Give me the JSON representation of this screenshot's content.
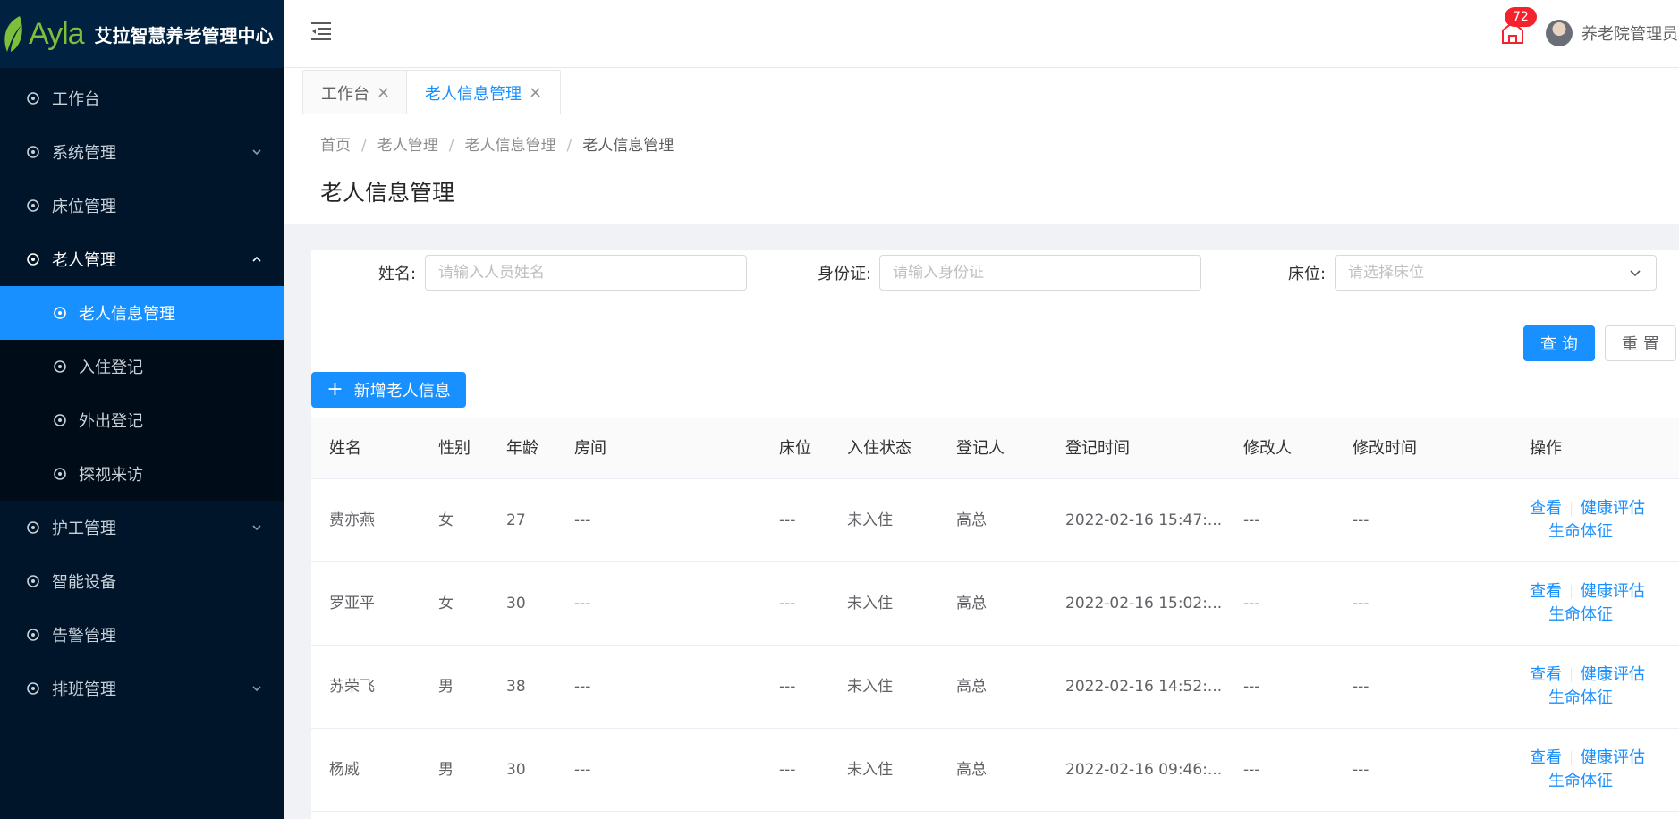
{
  "sidebar": {
    "brand": "Ayla",
    "title": "艾拉智慧养老管理中心",
    "items": [
      {
        "label": "工作台"
      },
      {
        "label": "系统管理"
      },
      {
        "label": "床位管理"
      },
      {
        "label": "老人管理"
      },
      {
        "label": "护工管理"
      },
      {
        "label": "智能设备"
      },
      {
        "label": "告警管理"
      },
      {
        "label": "排班管理"
      }
    ],
    "subitems": [
      {
        "label": "老人信息管理"
      },
      {
        "label": "入住登记"
      },
      {
        "label": "外出登记"
      },
      {
        "label": "探视来访"
      }
    ]
  },
  "header": {
    "notice_count": "72",
    "user_name": "养老院管理员"
  },
  "tabs": [
    {
      "label": "工作台",
      "close": "×"
    },
    {
      "label": "老人信息管理",
      "close": "×"
    }
  ],
  "breadcrumb": {
    "items": [
      "首页",
      "老人管理",
      "老人信息管理"
    ],
    "current": "老人信息管理",
    "separator": "/"
  },
  "page_title": "老人信息管理",
  "filters": {
    "name_label": "姓名:",
    "name_placeholder": "请输入人员姓名",
    "id_label": "身份证:",
    "id_placeholder": "请输入身份证",
    "bed_label": "床位:",
    "bed_placeholder": "请选择床位"
  },
  "buttons": {
    "query": "查 询",
    "reset": "重 置",
    "add": "新增老人信息"
  },
  "table": {
    "headers": [
      "姓名",
      "性别",
      "年龄",
      "房间",
      "床位",
      "入住状态",
      "登记人",
      "登记时间",
      "修改人",
      "修改时间",
      "操作"
    ],
    "rows": [
      {
        "name": "费亦燕",
        "gender": "女",
        "age": "27",
        "room": "---",
        "bed": "---",
        "status": "未入住",
        "registrar": "高总",
        "reg_time": "2022-02-16 15:47:...",
        "modifier": "---",
        "mod_time": "---"
      },
      {
        "name": "罗亚平",
        "gender": "女",
        "age": "30",
        "room": "---",
        "bed": "---",
        "status": "未入住",
        "registrar": "高总",
        "reg_time": "2022-02-16 15:02:...",
        "modifier": "---",
        "mod_time": "---"
      },
      {
        "name": "苏荣飞",
        "gender": "男",
        "age": "38",
        "room": "---",
        "bed": "---",
        "status": "未入住",
        "registrar": "高总",
        "reg_time": "2022-02-16 14:52:...",
        "modifier": "---",
        "mod_time": "---"
      },
      {
        "name": "杨威",
        "gender": "男",
        "age": "30",
        "room": "---",
        "bed": "---",
        "status": "未入住",
        "registrar": "高总",
        "reg_time": "2022-02-16 09:46:...",
        "modifier": "---",
        "mod_time": "---"
      }
    ],
    "actions": {
      "view": "查看",
      "health": "健康评估",
      "vitals": "生命体征"
    }
  },
  "colors": {
    "accent": "#1890ff",
    "sidebar_bg": "#001529",
    "badge": "#f5222d",
    "brand_green": "#7dbf3a"
  }
}
